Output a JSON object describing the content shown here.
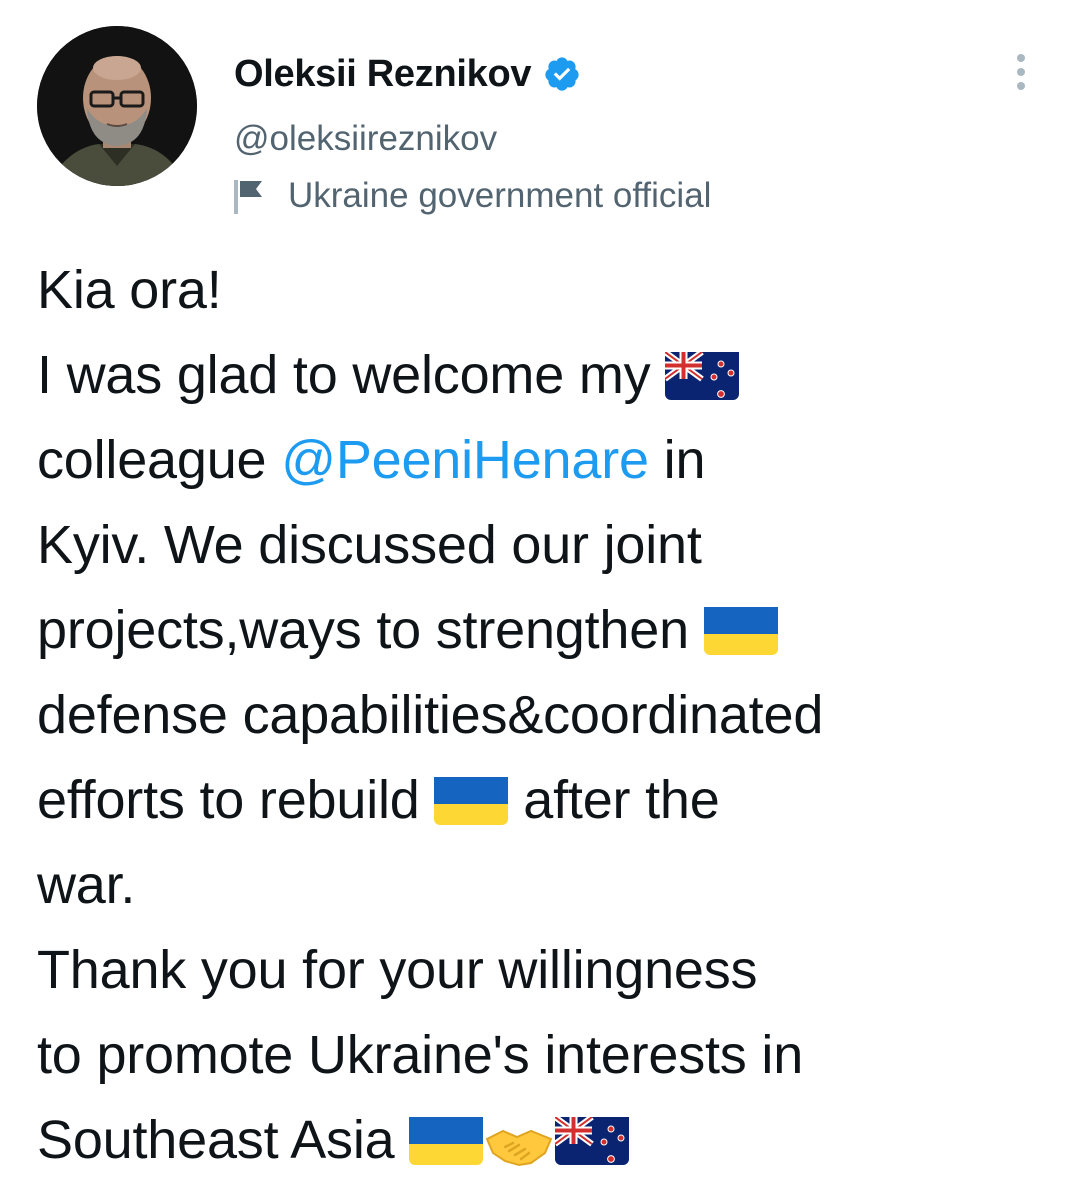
{
  "tweet": {
    "author": {
      "display_name": "Oleksii Reznikov",
      "handle": "@oleksiireznikov",
      "verified": true,
      "label": "Ukraine government official"
    },
    "text": {
      "line1": "Kia ora!",
      "line2": "I was glad to welcome my",
      "line3_a": "colleague ",
      "line3_mention": "@PeeniHenare",
      "line3_b": " in",
      "line4": "Kyiv. We discussed our joint",
      "line5": "projects,ways to strengthen",
      "line6": "defense capabilities&coordinated",
      "line7_a": "efforts to rebuild",
      "line7_b": "after the",
      "line8": "war.",
      "line9": "Thank you for your willingness",
      "line10": "to promote Ukraine's interests in",
      "line11": "Southeast Asia"
    },
    "icons": {
      "verified": "verified-badge-icon",
      "label": "government-flag-icon",
      "more": "more-options-icon",
      "emoji_nz": "new-zealand-flag-emoji",
      "emoji_ua": "ukraine-flag-emoji",
      "emoji_handshake": "handshake-emoji"
    },
    "colors": {
      "text": "#0f1419",
      "secondary": "#536471",
      "link": "#1d9bf0",
      "verified": "#1d9bf0"
    }
  }
}
